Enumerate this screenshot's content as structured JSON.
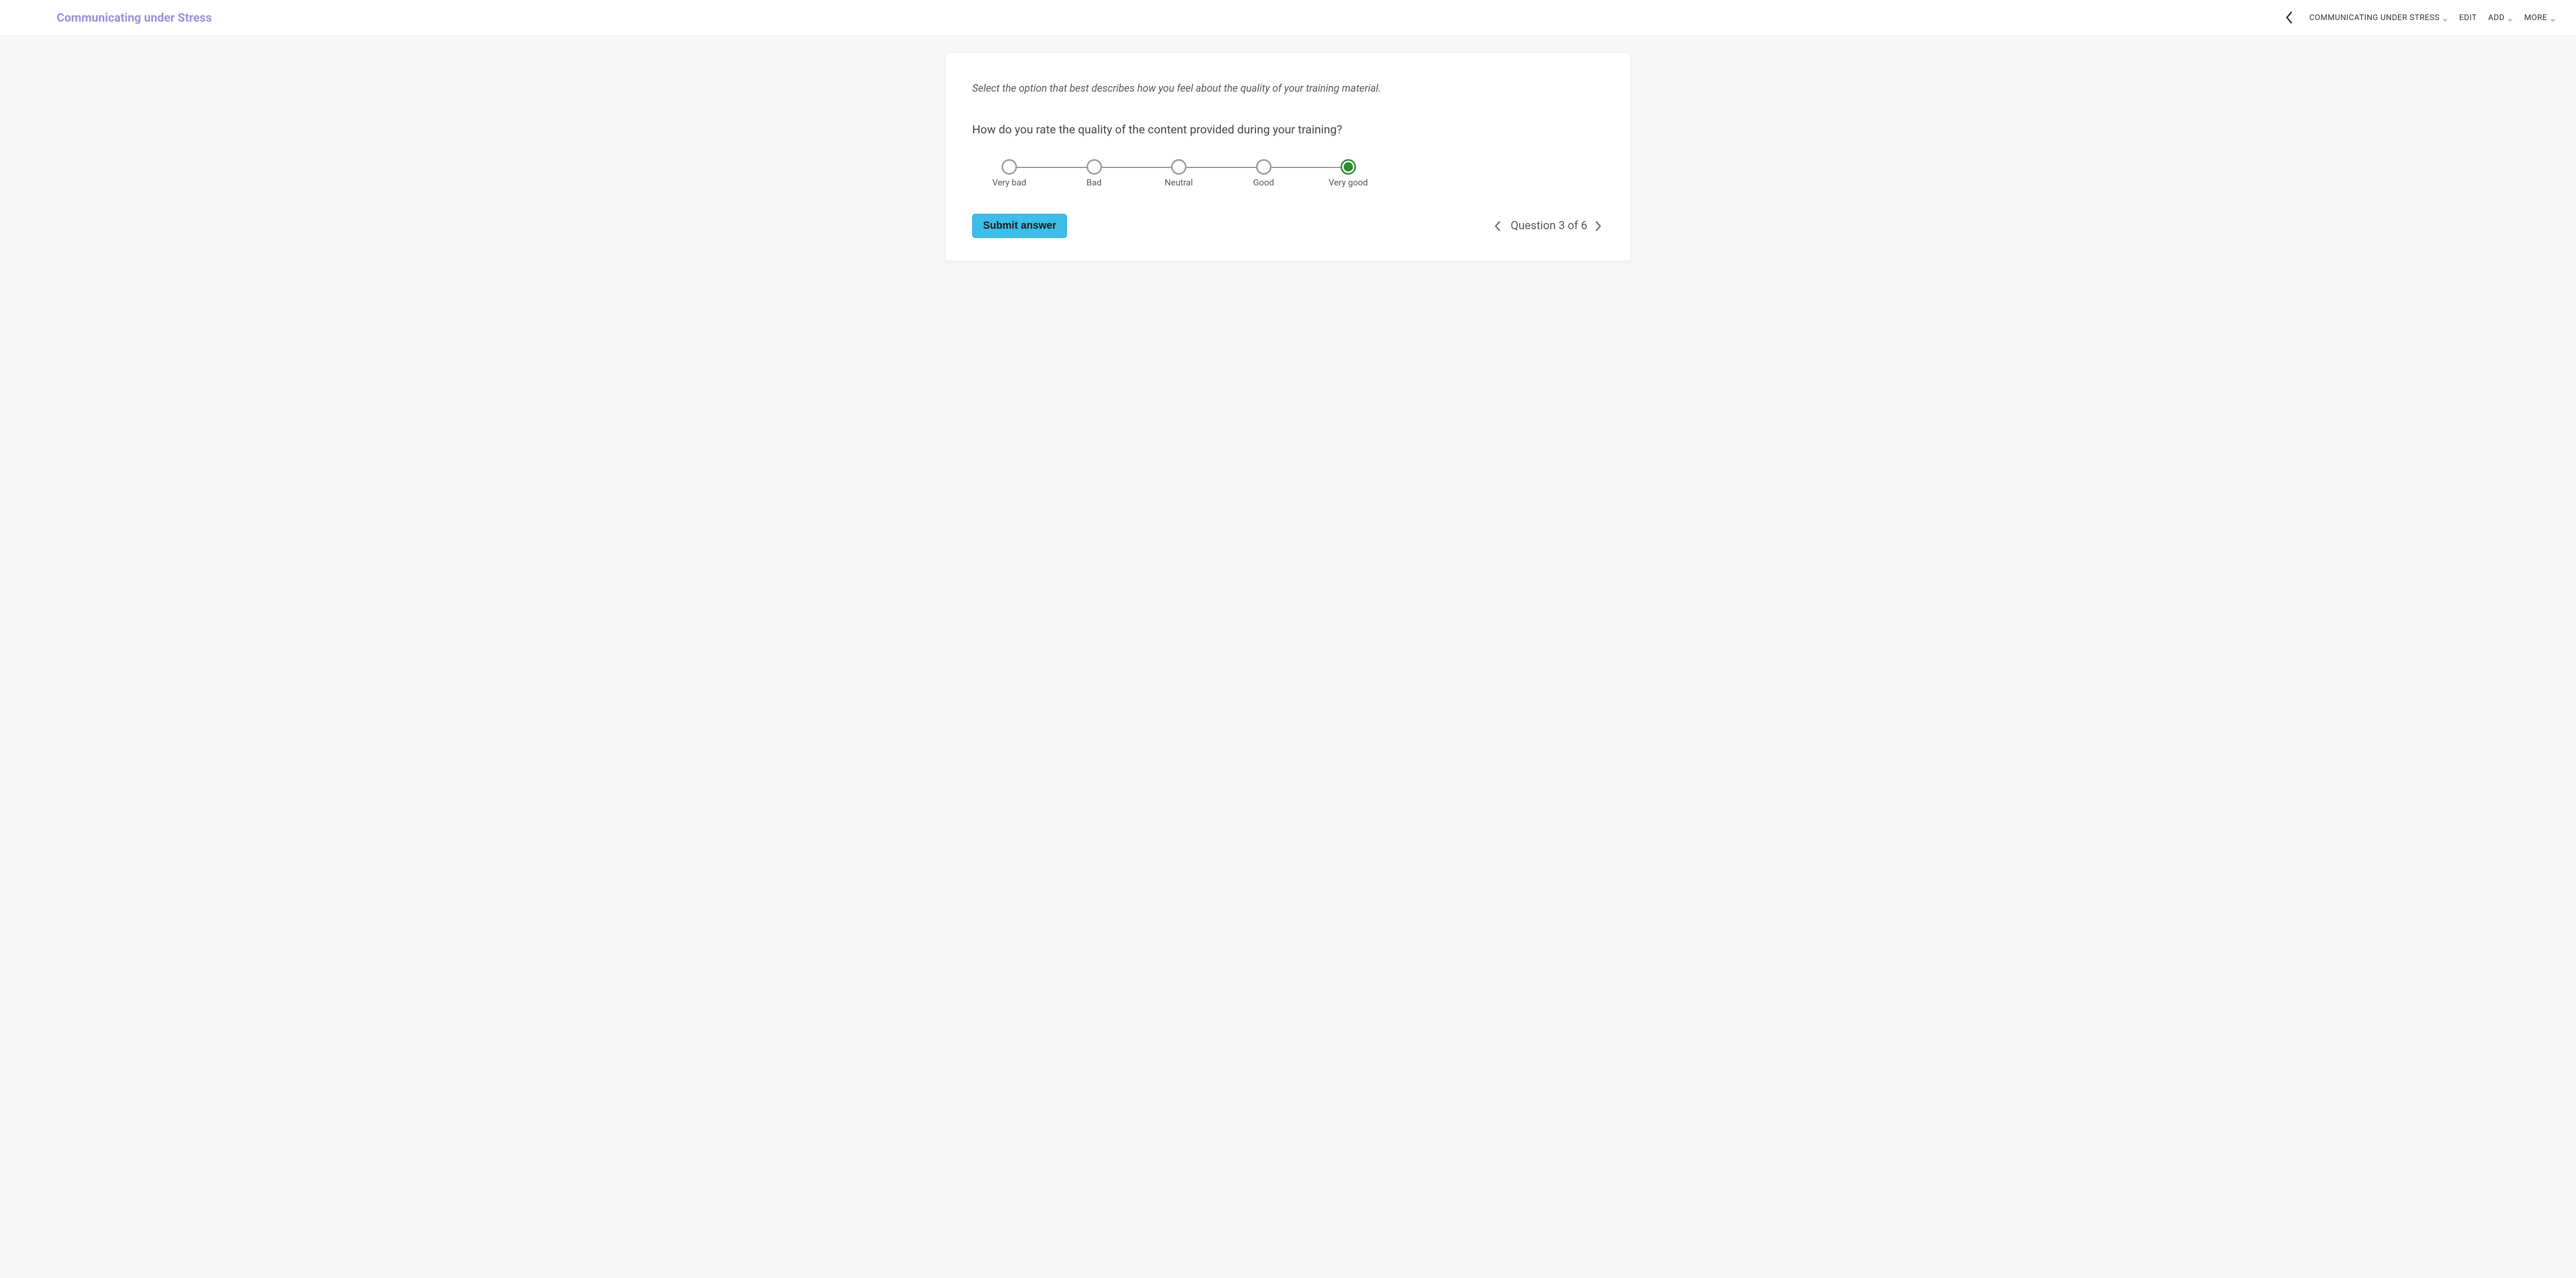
{
  "header": {
    "title": "Communicating under Stress",
    "nav": {
      "breadcrumb": "COMMUNICATING UNDER STRESS",
      "edit": "EDIT",
      "add": "ADD",
      "more": "MORE"
    }
  },
  "survey": {
    "instruction": "Select the option that best describes how you feel about the quality of your training material.",
    "question": "How do you rate the quality of the content provided during your training?",
    "options": [
      {
        "label": "Very bad",
        "selected": false
      },
      {
        "label": "Bad",
        "selected": false
      },
      {
        "label": "Neutral",
        "selected": false
      },
      {
        "label": "Good",
        "selected": false
      },
      {
        "label": "Very good",
        "selected": true
      }
    ],
    "submit_label": "Submit answer",
    "pager": {
      "text": "Question 3 of 6",
      "current": 3,
      "total": 6
    }
  }
}
